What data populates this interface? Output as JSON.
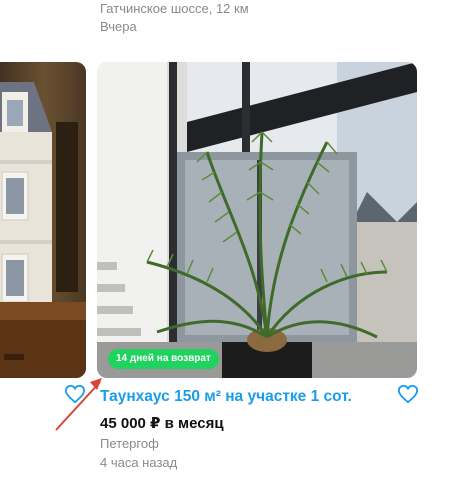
{
  "prev_listing": {
    "location": "Гатчинское шоссе, 12 км",
    "time": "Вчера"
  },
  "listing": {
    "badge": "14 дней на возврат",
    "title": "Таунхаус 150 м² на участке 1 сот.",
    "price": "45 000 ₽ в месяц",
    "location": "Петергоф",
    "time": "4 часа назад"
  },
  "colors": {
    "title": "#1a9dea",
    "badge": "#1fd35e",
    "heart": "#1a9dea",
    "annotation_arrow": "#d9453a"
  },
  "icons": {
    "favorite": "heart-outline-icon"
  }
}
